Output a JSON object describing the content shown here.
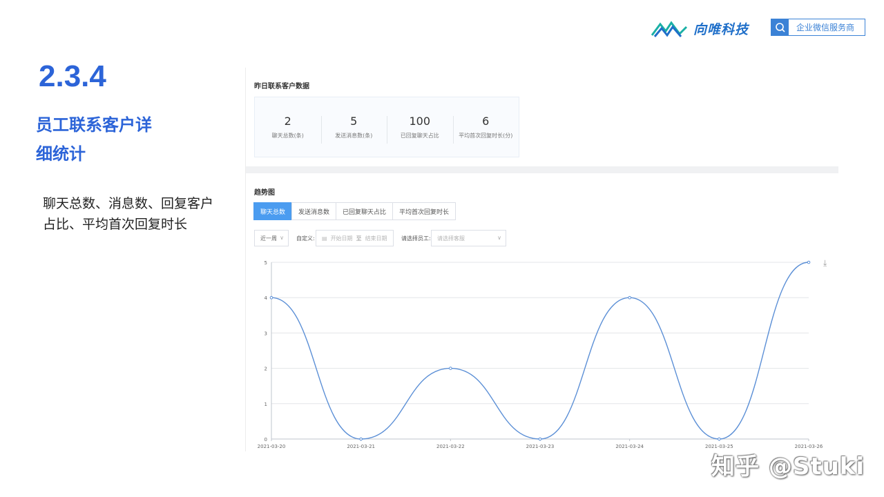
{
  "header": {
    "brand_name": "向唯科技",
    "badge_text": "企业微信服务商",
    "brand_color": "#1f6fc9",
    "badge_icon": "chat-search-icon"
  },
  "slide": {
    "section_number": "2.3.4",
    "title_line1": "员工联系客户详",
    "title_line2": "细统计",
    "desc_line1": "聊天总数、消息数、回复客户",
    "desc_line2": "占比、平均首次回复时长"
  },
  "panel": {
    "yesterday_title": "昨日联系客户数据",
    "stats": [
      {
        "value": "2",
        "label": "聊天总数(条)"
      },
      {
        "value": "5",
        "label": "发送消息数(条)"
      },
      {
        "value": "100",
        "label": "已回复聊天占比"
      },
      {
        "value": "6",
        "label": "平均首次回复时长(分)"
      }
    ],
    "trend_title": "趋势图",
    "tabs": [
      {
        "label": "聊天总数",
        "active": true
      },
      {
        "label": "发送消息数",
        "active": false
      },
      {
        "label": "已回复聊天占比",
        "active": false
      },
      {
        "label": "平均首次回复时长",
        "active": false
      }
    ],
    "filters": {
      "range_value": "近一周",
      "custom_label": "自定义:",
      "start_placeholder": "开始日期",
      "end_placeholder": "结束日期",
      "employee_label": "请选择员工:",
      "employee_placeholder": "请选择客服"
    }
  },
  "chart_data": {
    "type": "line",
    "smooth": true,
    "x": [
      "2021-03-20",
      "2021-03-21",
      "2021-03-22",
      "2021-03-23",
      "2021-03-24",
      "2021-03-25",
      "2021-03-26"
    ],
    "series": [
      {
        "values": [
          4,
          0,
          2,
          0,
          4,
          0,
          5
        ]
      }
    ],
    "ylim": [
      0,
      5
    ],
    "yticks": [
      "0",
      "1",
      "2",
      "3",
      "4",
      "5"
    ],
    "grid": true,
    "line_color": "#5b8fd6"
  },
  "watermark": "知乎 @Stuki"
}
